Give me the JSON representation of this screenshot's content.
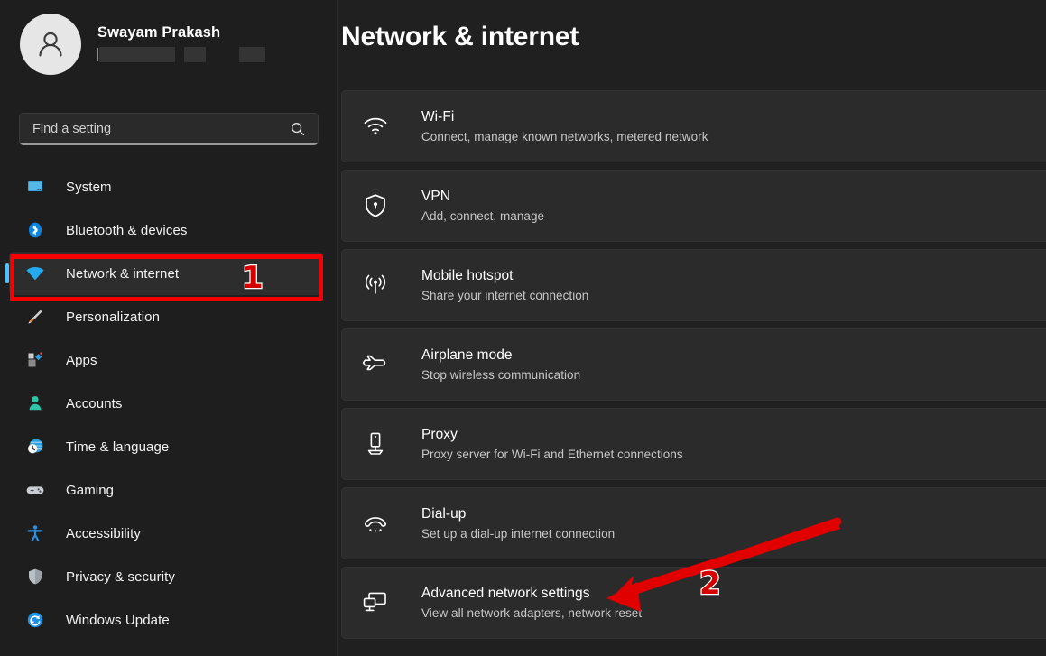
{
  "window": {
    "app": "Settings",
    "background_color": "#202020",
    "accent_color": "#4cc2ff",
    "annotation_color": "#f50000"
  },
  "sidebar": {
    "account": {
      "name": "Swayam Prakash",
      "avatar_icon": "person-avatar-icon",
      "redacted": true
    },
    "search": {
      "placeholder": "Find a setting",
      "value": "",
      "icon": "search-icon"
    },
    "items": [
      {
        "label": "System",
        "icon": "monitor-icon",
        "selected": false
      },
      {
        "label": "Bluetooth & devices",
        "icon": "bluetooth-icon",
        "selected": false
      },
      {
        "label": "Network & internet",
        "icon": "wifi-icon",
        "selected": true
      },
      {
        "label": "Personalization",
        "icon": "paintbrush-icon",
        "selected": false
      },
      {
        "label": "Apps",
        "icon": "apps-icon",
        "selected": false
      },
      {
        "label": "Accounts",
        "icon": "person-icon",
        "selected": false
      },
      {
        "label": "Time & language",
        "icon": "clock-globe-icon",
        "selected": false
      },
      {
        "label": "Gaming",
        "icon": "gamepad-icon",
        "selected": false
      },
      {
        "label": "Accessibility",
        "icon": "accessibility-icon",
        "selected": false
      },
      {
        "label": "Privacy & security",
        "icon": "shield-icon",
        "selected": false
      },
      {
        "label": "Windows Update",
        "icon": "update-refresh-icon",
        "selected": false
      }
    ]
  },
  "main": {
    "title": "Network & internet",
    "cards": [
      {
        "title": "Wi-Fi",
        "subtitle": "Connect, manage known networks, metered network",
        "icon": "wifi-icon"
      },
      {
        "title": "VPN",
        "subtitle": "Add, connect, manage",
        "icon": "shield-lock-icon"
      },
      {
        "title": "Mobile hotspot",
        "subtitle": "Share your internet connection",
        "icon": "hotspot-broadcast-icon"
      },
      {
        "title": "Airplane mode",
        "subtitle": "Stop wireless communication",
        "icon": "airplane-icon"
      },
      {
        "title": "Proxy",
        "subtitle": "Proxy server for Wi-Fi and Ethernet connections",
        "icon": "server-icon"
      },
      {
        "title": "Dial-up",
        "subtitle": "Set up a dial-up internet connection",
        "icon": "dialup-phone-icon"
      },
      {
        "title": "Advanced network settings",
        "subtitle": "View all network adapters, network reset",
        "icon": "network-adapter-icon"
      }
    ]
  },
  "annotations": {
    "markers": [
      {
        "label": "1",
        "target": "sidebar-item-network-internet"
      },
      {
        "label": "2",
        "target": "card-advanced-network-settings"
      }
    ],
    "arrow": {
      "points_to": "Advanced network settings",
      "color": "#e00000"
    }
  }
}
